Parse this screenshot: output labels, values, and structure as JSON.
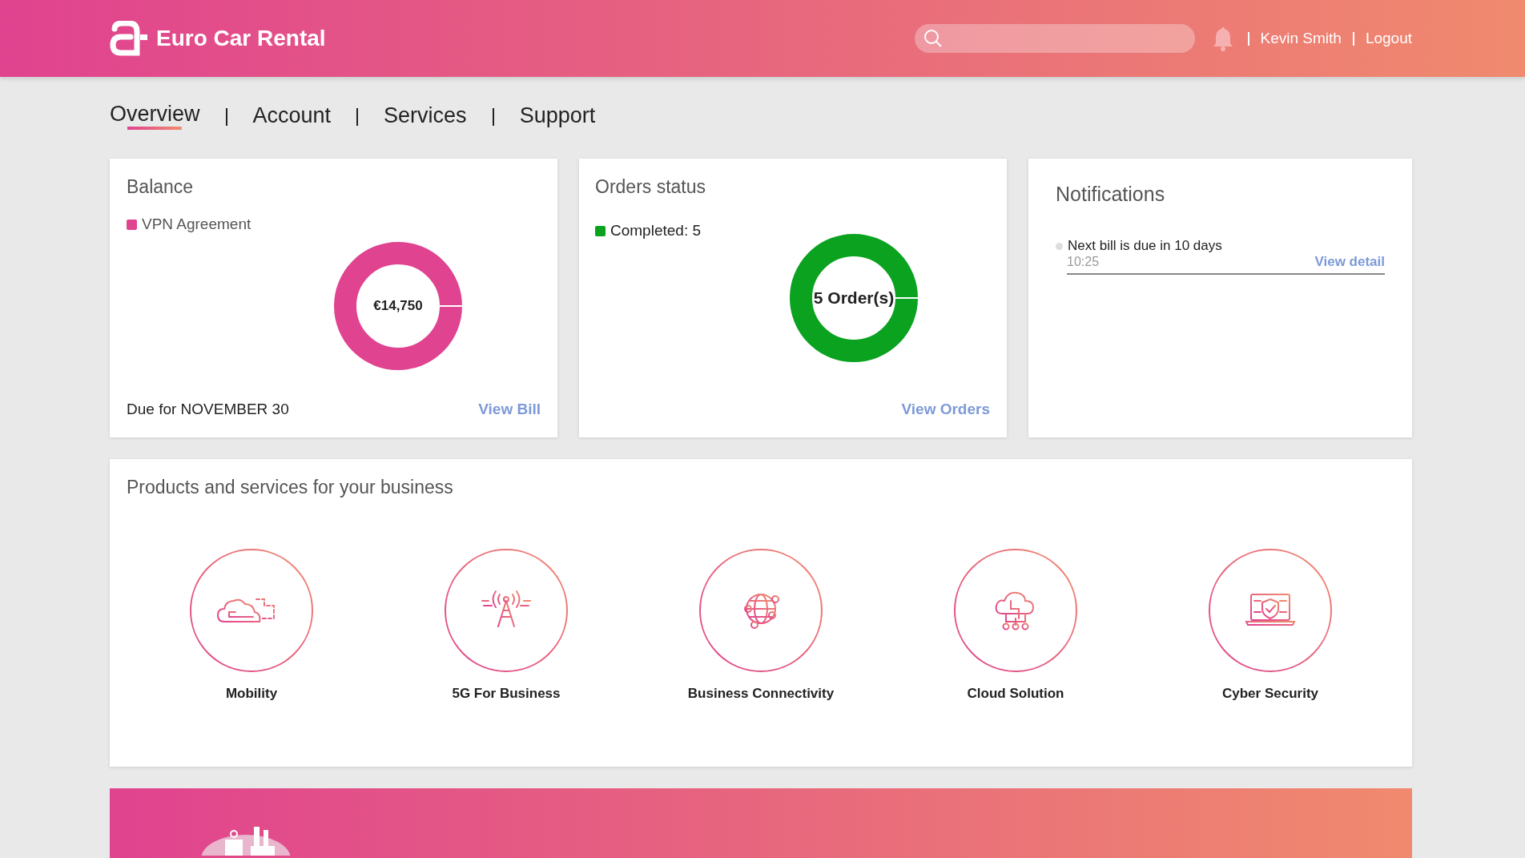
{
  "header": {
    "brand": "Euro Car Rental",
    "user": "Kevin Smith",
    "logout": "Logout"
  },
  "tabs": [
    {
      "label": "Overview",
      "selected": true
    },
    {
      "label": "Account",
      "selected": false
    },
    {
      "label": "Services",
      "selected": false
    },
    {
      "label": "Support",
      "selected": false
    }
  ],
  "balance": {
    "title": "Balance",
    "legend": [
      {
        "label": "VPN Agreement",
        "color": "#e0438f"
      }
    ],
    "center": "€14,750",
    "due": "Due for NOVEMBER 30",
    "link": "View Bill"
  },
  "orders": {
    "title": "Orders status",
    "legend": [
      {
        "label": "Completed: 5",
        "color": "#0aa21f"
      }
    ],
    "center": "5 Order(s)",
    "link": "View Orders"
  },
  "notifications": {
    "title": "Notifications",
    "items": [
      {
        "text": "Next bill is due in 10 days",
        "time": "10:25",
        "link": "View detail"
      }
    ]
  },
  "products": {
    "title": "Products and services for your business",
    "items": [
      {
        "label": "Mobility"
      },
      {
        "label": "5G For Business"
      },
      {
        "label": "Business Connectivity"
      },
      {
        "label": "Cloud Solution"
      },
      {
        "label": "Cyber Security"
      }
    ]
  }
}
